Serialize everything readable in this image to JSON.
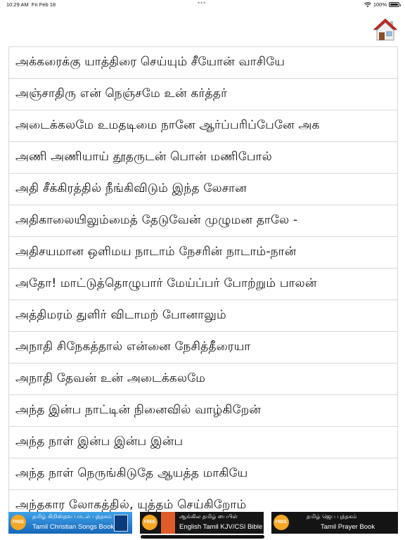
{
  "status_bar": {
    "time": "10:29 AM",
    "date": "Fri Feb 18",
    "multitask_dots": "•••",
    "battery_text": "100%"
  },
  "toolbar": {
    "home_icon": "home-icon"
  },
  "songs": [
    "அக்கரைக்கு யாத்திரை செய்யும் சீயோன் வாசியே",
    "அஞ்சாதிரு என் நெஞ்சமே உன் கர்த்தர்",
    "அடைக்கலமே உமதடிமை நானே ஆர்ப்பரிப்பேனே அக",
    "அணி அணியாய் தூதருடன் பொன் மணிபோல்",
    "அதி சீக்கிரத்தில் நீங்கிவிடும் இந்த லேசான",
    "அதிகாலையிலும்மைத் தேடுவேன் முழுமன தாலே -",
    "அதிசயமான ஒளிமய நாடாம் நேசரின் நாடாம்-நான்",
    "அதோ! மாட்டுத்தொழுபார் மேய்ப்பர் போற்றும் பாலன்",
    "அத்திமரம் துளிர் விடாமற் போனாலும்",
    "அநாதி சிநேகத்தால் என்னை நேசித்தீரையா",
    "அநாதி தேவன் உன் அடைக்கலமே",
    "அந்த இன்ப நாட்டின் நினைவில் வாழ்கிறேன்",
    "அந்த நாள் இன்ப இன்ப இன்ப",
    "அந்த நாள் நெருங்கிடுதே ஆயத்த மாகியே",
    "அந்தகார லோகத்தில், யுத்தம் செய்கிறோம்"
  ],
  "ads": [
    {
      "badge": "FREE",
      "line1": "தமிழ் கிறிஸ்தவ பாடல் புத்தகம்",
      "line2": "Tamil Christian Songs Book"
    },
    {
      "badge": "FREE",
      "line1": "ஆங்கில தமிழ் பைபிள்",
      "line2": "English Tamil KJV/CSI Bible"
    },
    {
      "badge": "FREE",
      "line1": "தமிழ் ஜெப புத்தகம்",
      "line2": "Tamil Prayer Book"
    }
  ]
}
